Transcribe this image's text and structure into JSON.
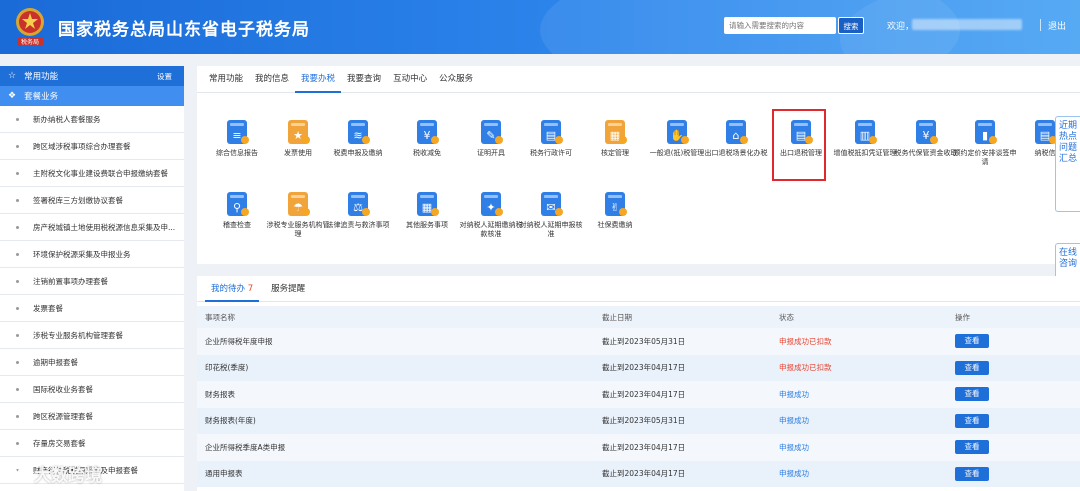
{
  "header": {
    "title": "国家税务总局山东省电子税务局",
    "search_placeholder": "请输入需要搜索的内容",
    "search_button": "搜索",
    "welcome": "欢迎，",
    "logout": "退出",
    "emblem_text": "税务局"
  },
  "sidebar": {
    "common_label": "常用功能",
    "settings_label": "设置",
    "package_label": "套餐业务",
    "items": [
      "新办纳税人套餐服务",
      "跨区域涉税事项综合办理套餐",
      "主附税文化事业建设费联合申报缴纳套餐",
      "签署税库三方划缴协议套餐",
      "房产税城镇土地使用税税源信息采集及申...",
      "环境保护税源采集及申报业务",
      "注销前置事项办理套餐",
      "发票套餐",
      "涉税专业服务机构管理套餐",
      "逾期申报套餐",
      "国际税收业务套餐",
      "跨区税源管理套餐",
      "存量房交易套餐",
      "财产行为税税源采集及申报套餐"
    ]
  },
  "tabs": [
    "常用功能",
    "我的信息",
    "我要办税",
    "我要查询",
    "互动中心",
    "公众服务"
  ],
  "active_tab": 2,
  "services": [
    {
      "label": "综合信息报告",
      "icon": "report-icon"
    },
    {
      "label": "发票使用",
      "icon": "invoice-icon"
    },
    {
      "label": "税费申报及缴纳",
      "icon": "declare-icon"
    },
    {
      "label": "税收减免",
      "icon": "tax-reduction-icon"
    },
    {
      "label": "证明开具",
      "icon": "certificate-icon"
    },
    {
      "label": "税务行政许可",
      "icon": "license-icon"
    },
    {
      "label": "核定管理",
      "icon": "folder-icon"
    },
    {
      "label": "一般退(抵)税管理",
      "icon": "refund-icon"
    },
    {
      "label": "出口退税场景化办税",
      "icon": "export-scene-icon"
    },
    {
      "label": "出口退税管理",
      "icon": "export-refund-icon"
    },
    {
      "label": "增值税抵扣凭证管理",
      "icon": "vat-voucher-icon"
    },
    {
      "label": "税务代保管资金收取",
      "icon": "custody-fund-icon"
    },
    {
      "label": "预约定价安排谈签申请",
      "icon": "pricing-icon"
    },
    {
      "label": "纳税信",
      "icon": "credit-icon"
    },
    {
      "label": "稽查检查",
      "icon": "inspection-icon"
    },
    {
      "label": "涉税专业服务机构管理",
      "icon": "service-agency-icon"
    },
    {
      "label": "法律追责与救济事项",
      "icon": "gavel-icon"
    },
    {
      "label": "其他服务事项",
      "icon": "grid-icon"
    },
    {
      "label": "对纳税人延期缴纳税款核准",
      "icon": "deferral-pay-icon"
    },
    {
      "label": "对纳税人延期申报核准",
      "icon": "deferral-declare-icon"
    },
    {
      "label": "社保费缴纳",
      "icon": "social-security-icon"
    }
  ],
  "float_tabs": [
    "近期热点问题汇总",
    "在线咨询"
  ],
  "todo": {
    "tabs": [
      "我的待办",
      "服务提醒"
    ],
    "count": "7",
    "columns": [
      "事项名称",
      "截止日期",
      "状态",
      "操作"
    ],
    "view_label": "查看",
    "rows": [
      {
        "name": "企业所得税年度申报",
        "deadline": "截止到2023年05月31日",
        "status": "申报成功已扣款",
        "status_color": "#e8432e"
      },
      {
        "name": "印花税(季度)",
        "deadline": "截止到2023年04月17日",
        "status": "申报成功已扣款",
        "status_color": "#e8432e"
      },
      {
        "name": "财务报表",
        "deadline": "截止到2023年04月17日",
        "status": "申报成功",
        "status_color": "#2a7be0"
      },
      {
        "name": "财务报表(年度)",
        "deadline": "截止到2023年05月31日",
        "status": "申报成功",
        "status_color": "#2a7be0"
      },
      {
        "name": "企业所得税季度A类申报",
        "deadline": "截止到2023年04月17日",
        "status": "申报成功",
        "status_color": "#2a7be0"
      },
      {
        "name": "通用申报表",
        "deadline": "截止到2023年04月17日",
        "status": "申报成功",
        "status_color": "#2a7be0"
      }
    ]
  },
  "watermark": "大数跨境",
  "colors": {
    "primary": "#1f6fd9",
    "highlight": "#e0292f"
  }
}
